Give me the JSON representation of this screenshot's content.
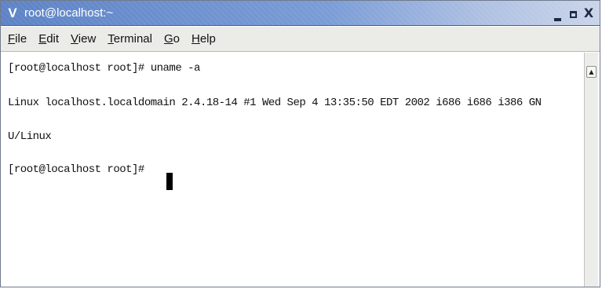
{
  "window": {
    "menu_glyph": "V",
    "title": "root@localhost:~",
    "controls": {
      "close_glyph": "X"
    }
  },
  "menubar": {
    "items": [
      {
        "label": "File",
        "mnemonic": "F",
        "rest": "ile"
      },
      {
        "label": "Edit",
        "mnemonic": "E",
        "rest": "dit"
      },
      {
        "label": "View",
        "mnemonic": "V",
        "rest": "iew"
      },
      {
        "label": "Terminal",
        "mnemonic": "T",
        "rest": "erminal"
      },
      {
        "label": "Go",
        "mnemonic": "G",
        "rest": "o"
      },
      {
        "label": "Help",
        "mnemonic": "H",
        "rest": "elp"
      }
    ]
  },
  "terminal": {
    "lines": [
      "[root@localhost root]# uname -a",
      "Linux localhost.localdomain 2.4.18-14 #1 Wed Sep 4 13:35:50 EDT 2002 i686 i686 i386 GN",
      "U/Linux",
      "[root@localhost root]# "
    ]
  },
  "scrollbar": {
    "up_glyph": "▲"
  }
}
